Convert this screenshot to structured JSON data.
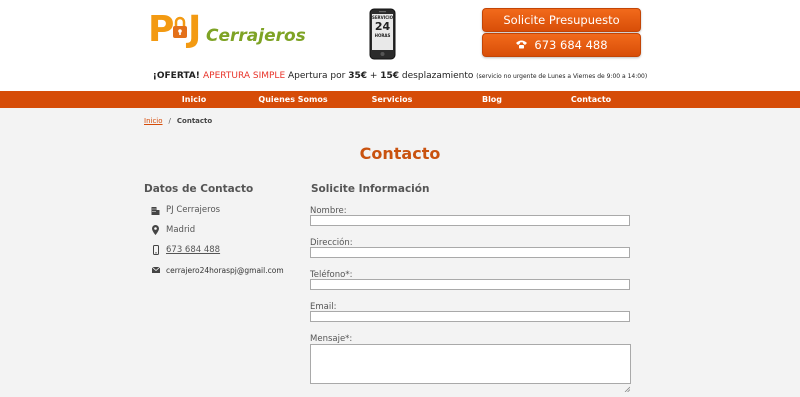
{
  "header": {
    "logo": {
      "initial_p": "P",
      "initial_j": "J",
      "name": "Cerrajeros"
    },
    "badge": {
      "top": "SERVICIO",
      "number": "24",
      "bottom": "HORAS"
    },
    "quote_button": "Solicite Presupuesto",
    "phone_button": "673 684 488"
  },
  "offer": {
    "prefix": "¡OFERTA! ",
    "highlight": "APERTURA SIMPLE",
    "mid": " Apertura por ",
    "price": "35€",
    "plus": " + ",
    "fee": "15€",
    "suffix": " desplazamiento",
    "note": "(servicio no urgente de Lunes a Viernes de 9:00 a 14:00)"
  },
  "nav": {
    "items": [
      {
        "label": "Inicio"
      },
      {
        "label": "Quienes Somos"
      },
      {
        "label": "Servicios"
      },
      {
        "label": "Blog"
      },
      {
        "label": "Contacto"
      }
    ]
  },
  "breadcrumb": {
    "home": "Inicio",
    "separator": "/",
    "current": "Contacto"
  },
  "page": {
    "title": "Contacto"
  },
  "contact": {
    "heading": "Datos de Contacto",
    "company": "PJ Cerrajeros",
    "city": "Madrid",
    "phone": "673 684 488",
    "email": "cerrajero24horaspj@gmail.com"
  },
  "form": {
    "heading": "Solicite Información",
    "fields": [
      {
        "label": "Nombre:",
        "value": ""
      },
      {
        "label": "Dirección:",
        "value": ""
      },
      {
        "label": "Teléfono*:",
        "value": ""
      },
      {
        "label": "Email:",
        "value": ""
      },
      {
        "label": "Mensaje*:",
        "value": ""
      }
    ]
  },
  "colors": {
    "brand_orange": "#d64c08",
    "logo_orange": "#f39a12",
    "logo_green": "#7ea325",
    "offer_red": "#e8342a",
    "page_background": "#f3f3f3"
  },
  "icons": [
    "lock-icon",
    "phone-badge-icon",
    "phone-handset-icon",
    "building-icon",
    "map-marker-icon",
    "mobile-phone-icon",
    "envelope-icon"
  ]
}
